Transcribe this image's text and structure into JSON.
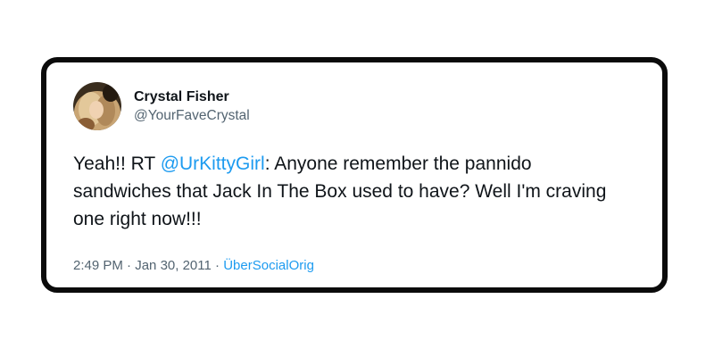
{
  "tweet": {
    "author": {
      "display_name": "Crystal Fisher",
      "handle": "@YourFaveCrystal"
    },
    "text": {
      "before": "Yeah!! RT ",
      "mention": "@UrKittyGirl",
      "after": ": Anyone remember the pannido sandwiches that Jack In The Box used to have? Well I'm craving one right now!!!"
    },
    "meta": {
      "time": "2:49 PM",
      "separator1": " · ",
      "date": "Jan 30, 2011",
      "separator2": " · ",
      "source": "ÜberSocialOrig"
    }
  },
  "colors": {
    "link": "#1d9bf0",
    "text": "#0f1419",
    "secondary": "#536471",
    "border": "#0b0b0b"
  }
}
